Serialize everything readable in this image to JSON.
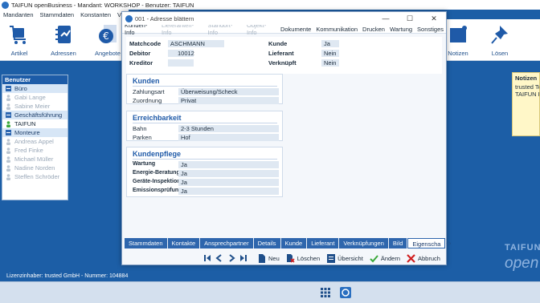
{
  "app": {
    "title": "TAIFUN openBusiness - Mandant: WORKSHOP - Benutzer: TAIFUN",
    "menu": [
      "Mandanten",
      "Stammdaten",
      "Konstanten",
      "Verkauf"
    ]
  },
  "ribbon": {
    "buttons": [
      {
        "label": "Artikel",
        "icon": "cart-icon"
      },
      {
        "label": "Adressen",
        "icon": "address-book-icon"
      },
      {
        "label": "Angebote",
        "icon": "euro-document-icon"
      },
      {
        "label": "Notizen",
        "icon": "note-pin-icon"
      },
      {
        "label": "Lösen",
        "icon": "pushpin-icon"
      }
    ]
  },
  "navigator": {
    "header": "Benutzer",
    "rows": [
      {
        "label": "Büro",
        "type": "group"
      },
      {
        "label": "Gabi Lange",
        "type": "person"
      },
      {
        "label": "Sabine Meier",
        "type": "person"
      },
      {
        "label": "Geschäftsführung",
        "type": "group"
      },
      {
        "label": "TAIFUN",
        "type": "person-active"
      },
      {
        "label": "Monteure",
        "type": "group"
      },
      {
        "label": "Andreas Appel",
        "type": "person"
      },
      {
        "label": "Fred Finke",
        "type": "person"
      },
      {
        "label": "Michael Müller",
        "type": "person"
      },
      {
        "label": "Nadine Norden",
        "type": "person"
      },
      {
        "label": "Steffen Schröder",
        "type": "person"
      }
    ]
  },
  "notes": {
    "header": "Notizen",
    "line1": "trusted Te",
    "line2": "TAIFUN H"
  },
  "dialog": {
    "title": "001 - Adresse blättern",
    "menu": [
      {
        "label": "Kunden-Info",
        "enabled": true
      },
      {
        "label": "Lieferanten-Info",
        "enabled": false
      },
      {
        "label": "Standort-Info",
        "enabled": false
      },
      {
        "label": "Objekt-Info",
        "enabled": false
      },
      {
        "label": "Dokumente",
        "enabled": true
      },
      {
        "label": "Kommunikation",
        "enabled": true
      },
      {
        "label": "Drucken",
        "enabled": true
      },
      {
        "label": "Wartung",
        "enabled": true
      },
      {
        "label": "Sonstiges",
        "enabled": true
      }
    ],
    "header_fields": {
      "matchcode_label": "Matchcode",
      "matchcode": "ASCHMANN",
      "debitor_label": "Debitor",
      "debitor": "10012",
      "kreditor_label": "Kreditor",
      "kreditor": "",
      "kunde_label": "Kunde",
      "kunde": "Ja",
      "lieferant_label": "Lieferant",
      "lieferant": "Nein",
      "verknuepft_label": "Verknüpft",
      "verknuepft": "Nein"
    },
    "kunden": {
      "title": "Kunden",
      "zahlungsart_label": "Zahlungsart",
      "zahlungsart": "Überweisung/Scheck",
      "zuordnung_label": "Zuordnung",
      "zuordnung": "Privat"
    },
    "erreichbarkeit": {
      "title": "Erreichbarkeit",
      "bahn_label": "Bahn",
      "bahn": "2-3 Stunden",
      "parken_label": "Parken",
      "parken": "Hof"
    },
    "kundenpflege": {
      "title": "Kundenpflege",
      "rows": [
        {
          "label": "Wartung",
          "value": "Ja"
        },
        {
          "label": "Energie-Beratung",
          "value": "Ja"
        },
        {
          "label": "Geräte-Inspektion",
          "value": "Ja"
        },
        {
          "label": "Emissionsprüfung",
          "value": "Ja"
        }
      ]
    },
    "tabs": [
      "Stammdaten",
      "Kontakte",
      "Ansprechpartner",
      "Details",
      "Kunde",
      "Lieferant",
      "Verknüpfungen",
      "Bild",
      "Eigenscha"
    ],
    "active_tab": "Eigenscha",
    "actions": {
      "neu": "Neu",
      "loeschen": "Löschen",
      "uebersicht": "Übersicht",
      "aendern": "Ändern",
      "abbruch": "Abbruch"
    }
  },
  "footer": {
    "license": "Lizenzinhaber: trusted GmbH - Nummer: 104884",
    "brand_top": "TAIFUN",
    "brand_bottom": "open"
  },
  "colors": {
    "background": "#1c5ea6",
    "accent": "#2e66ad",
    "field_bg": "#dfe8f2",
    "section_title": "#1f5aa8"
  }
}
